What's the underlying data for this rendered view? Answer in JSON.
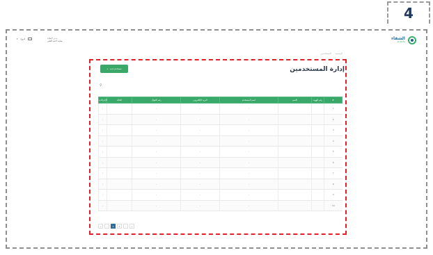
{
  "step_badge": "4",
  "topbar": {
    "tools": [
      "▾",
      "خروج"
    ],
    "user_line1": "مدير النظام",
    "user_line2": "محمد أحمد العلي"
  },
  "brand": {
    "name": "الشفاء",
    "subtitle": "Al-Shifa"
  },
  "breadcrumb": {
    "home": "الرئيسية",
    "current": "المستخدمين"
  },
  "page": {
    "title": "إدارة المستخدمين",
    "add_button": "مستخدم جديد"
  },
  "table": {
    "columns": [
      "#",
      "رقم الهوية",
      "الاسم",
      "اسم المستخدم",
      "البريد الإلكتروني",
      "رقم الجوال",
      "الحالة",
      "الإجراءات"
    ],
    "rows": [
      [
        "1",
        "",
        "",
        "-",
        "-",
        "-",
        "",
        "⋮"
      ],
      [
        "2",
        "",
        "",
        "-",
        "-",
        "-",
        "",
        "⋮"
      ],
      [
        "3",
        "",
        "",
        "-",
        "-",
        "-",
        "",
        "⋮"
      ],
      [
        "4",
        "",
        "",
        "-",
        "-",
        "-",
        "",
        "⋮"
      ],
      [
        "5",
        "",
        "",
        "-",
        "-",
        "-",
        "",
        "⋮"
      ],
      [
        "6",
        "",
        "",
        "-",
        "-",
        "-",
        "",
        "⋮"
      ],
      [
        "7",
        "",
        "",
        "-",
        "-",
        "-",
        "",
        "⋮"
      ],
      [
        "8",
        "",
        "",
        "-",
        "-",
        "-",
        "",
        "⋮"
      ],
      [
        "9",
        "",
        "",
        "-",
        "-",
        "-",
        "",
        "⋮"
      ],
      [
        "10",
        "",
        "",
        "-",
        "-",
        "-",
        "",
        "⋮"
      ]
    ]
  },
  "pager": {
    "buttons": [
      "«",
      "‹",
      "1",
      "2",
      "›",
      "»"
    ],
    "active_index": 2
  }
}
